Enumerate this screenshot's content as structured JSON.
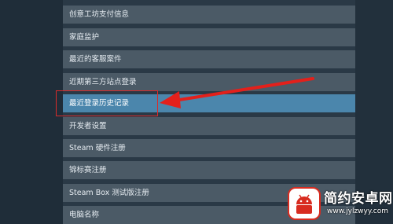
{
  "menu": {
    "items": [
      {
        "label": "创意工坊支付信息",
        "selected": false
      },
      {
        "label": "家庭监护",
        "selected": false
      },
      {
        "label": "最近的客服案件",
        "selected": false
      },
      {
        "label": "近期第三方站点登录",
        "selected": false
      },
      {
        "label": "最近登录历史记录",
        "selected": true
      },
      {
        "label": "开发者设置",
        "selected": false
      },
      {
        "label": "Steam 硬件注册",
        "selected": false
      },
      {
        "label": "锦标赛注册",
        "selected": false
      },
      {
        "label": "Steam Box 测试版注册",
        "selected": false
      },
      {
        "label": "电脑名称",
        "selected": false
      }
    ]
  },
  "annotation": {
    "highlight_color": "#d92b2b",
    "arrow_color": "#e3201b",
    "target_item": "最近登录历史记录"
  },
  "watermark": {
    "title": "简约安卓网",
    "url": "www.jylzwyy.com",
    "icon": "android-robot-icon"
  },
  "colors": {
    "item_bg": "#4b5a66",
    "selected_bg": "#4b86ac",
    "page_bg": "#24333f"
  }
}
